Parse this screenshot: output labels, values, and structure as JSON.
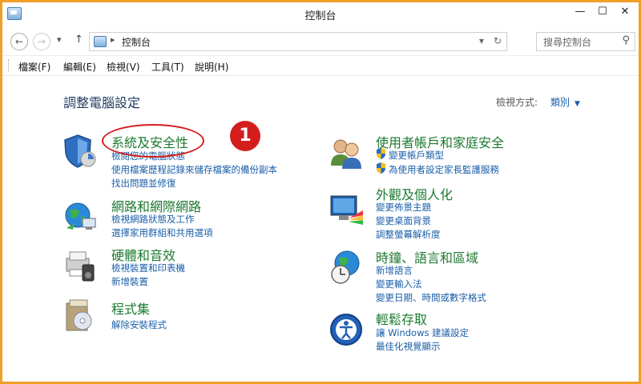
{
  "window": {
    "title": "控制台",
    "min_glyph": "—",
    "max_glyph": "☐",
    "close_glyph": "✕"
  },
  "nav": {
    "back_glyph": "←",
    "forward_glyph": "→",
    "dropdown_glyph": "▾",
    "up_glyph": "↑",
    "breadcrumb_sep": "▸",
    "address": "控制台",
    "address_dropdown_glyph": "▾",
    "refresh_glyph": "↻",
    "search_placeholder": "搜尋控制台",
    "search_glyph": "⚲"
  },
  "menu": [
    "檔案(F)",
    "編輯(E)",
    "檢視(V)",
    "工具(T)",
    "說明(H)"
  ],
  "main": {
    "heading": "調整電腦設定",
    "view_label": "檢視方式:",
    "view_value": "類別",
    "view_dropdown_glyph": "▼"
  },
  "left_categories": [
    {
      "title": "系統及安全性",
      "links": [
        "檢閱您的電腦狀態",
        "使用檔案歷程記錄來儲存檔案的備份副本",
        "找出問題並修復"
      ]
    },
    {
      "title": "網路和網際網路",
      "links": [
        "檢視網路狀態及工作",
        "選擇家用群組和共用選項"
      ]
    },
    {
      "title": "硬體和音效",
      "links": [
        "檢視裝置和印表機",
        "新增裝置"
      ]
    },
    {
      "title": "程式集",
      "links": [
        "解除安裝程式"
      ]
    }
  ],
  "right_categories": [
    {
      "title": "使用者帳戶和家庭安全",
      "links": [
        "變更帳戶類型",
        "為使用者設定家長監護服務"
      ]
    },
    {
      "title": "外觀及個人化",
      "links": [
        "變更佈景主題",
        "變更桌面背景",
        "調整螢幕解析度"
      ]
    },
    {
      "title": "時鐘、語言和區域",
      "links": [
        "新增語言",
        "變更輸入法",
        "變更日期、時間或數字格式"
      ]
    },
    {
      "title": "輕鬆存取",
      "links": [
        "讓 Windows 建議設定",
        "最佳化視覺顯示"
      ]
    }
  ],
  "annotation": {
    "number": "1"
  },
  "colors": {
    "accent_border": "#f0a028",
    "category_title": "#1c7a2f",
    "link": "#1a5ea8",
    "annotation": "#d41e1e"
  }
}
